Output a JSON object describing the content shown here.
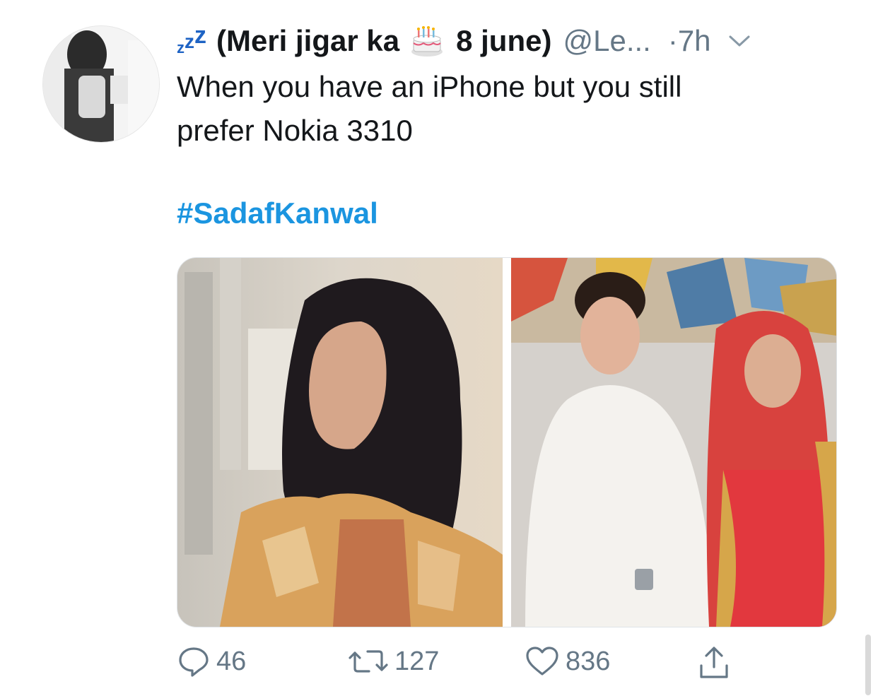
{
  "tweet": {
    "author": {
      "zzz": [
        "z",
        "z",
        "z"
      ],
      "name_part1": "(Meri jigar ka",
      "name_part2": "8 june)",
      "handle": "@Le...",
      "time": "·7h",
      "avatar_icon": "avatar-photo",
      "birthday_icon": "birthday-cake-icon"
    },
    "text_line1": "When you have an iPhone but you still",
    "text_line2": "prefer Nokia 3310",
    "hashtag": "#SadafKanwal",
    "media": {
      "left_image": "woman-in-orange-kurta-portrait",
      "right_image": "couple-seated-in-white-and-red"
    },
    "actions": {
      "reply_count": "46",
      "retweet_count": "127",
      "like_count": "836",
      "reply_icon": "reply-icon",
      "retweet_icon": "retweet-icon",
      "like_icon": "heart-icon",
      "share_icon": "share-icon"
    }
  }
}
